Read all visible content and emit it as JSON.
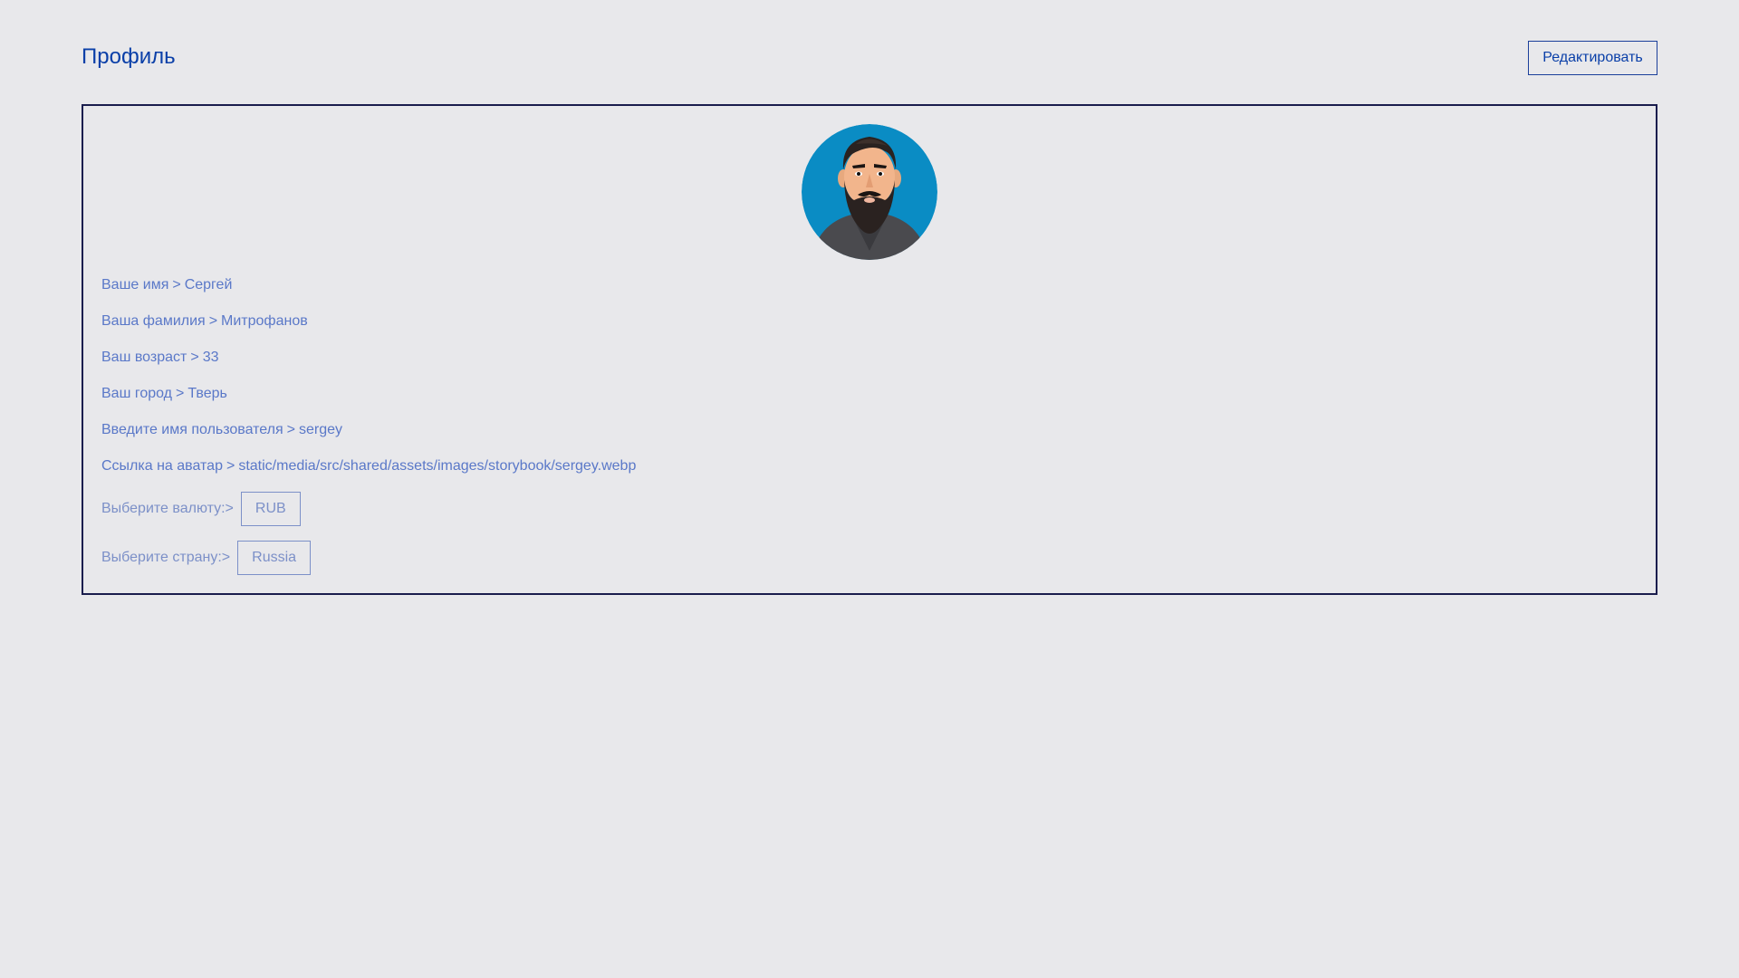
{
  "header": {
    "title": "Профиль",
    "edit_label": "Редактировать"
  },
  "profile": {
    "avatar_icon": "bearded-man-avatar",
    "separator": ">",
    "fields": [
      {
        "label": "Ваше имя",
        "value": "Сергей"
      },
      {
        "label": "Ваша фамилия",
        "value": "Митрофанов"
      },
      {
        "label": "Ваш возраст",
        "value": "33"
      },
      {
        "label": "Ваш город",
        "value": "Тверь"
      },
      {
        "label": "Введите имя пользователя",
        "value": "sergey"
      },
      {
        "label": "Ссылка на аватар",
        "value": "static/media/src/shared/assets/images/storybook/sergey.webp"
      }
    ],
    "currency": {
      "label": "Выберите валюту:>",
      "value": "RUB"
    },
    "country": {
      "label": "Выберите страну:>",
      "value": "Russia"
    }
  },
  "colors": {
    "background": "#e8e8eb",
    "accent": "#0a3fa8",
    "text_muted": "#5a78c8",
    "card_border": "#1a1d4d"
  }
}
